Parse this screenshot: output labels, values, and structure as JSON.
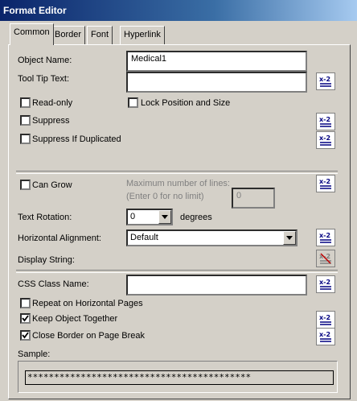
{
  "window": {
    "title": "Format Editor"
  },
  "tabs": [
    {
      "label": "Common"
    },
    {
      "label": "Border"
    },
    {
      "label": "Font"
    },
    {
      "label": "Hyperlink"
    }
  ],
  "common": {
    "object_name_label": "Object Name:",
    "object_name_value": "Medical1",
    "tooltip_label": "Tool Tip Text:",
    "tooltip_value": "",
    "read_only_label": "Read-only",
    "lock_position_label": "Lock Position and Size",
    "suppress_label": "Suppress",
    "suppress_dup_label": "Suppress If Duplicated",
    "can_grow_label": "Can Grow",
    "max_lines_label": "Maximum number of lines:",
    "max_lines_hint": "(Enter 0 for no limit)",
    "max_lines_value": "0",
    "text_rotation_label": "Text Rotation:",
    "text_rotation_value": "0",
    "degrees_label": "degrees",
    "horiz_align_label": "Horizontal Alignment:",
    "horiz_align_value": "Default",
    "display_string_label": "Display String:",
    "css_class_label": "CSS Class Name:",
    "css_class_value": "",
    "repeat_pages_label": "Repeat on Horizontal Pages",
    "keep_together_label": "Keep Object Together",
    "close_border_label": "Close Border on Page Break",
    "sample_label": "Sample:",
    "sample_value": "******************************************"
  },
  "checks": {
    "read_only": false,
    "lock_position": false,
    "suppress": false,
    "suppress_dup": false,
    "can_grow": false,
    "repeat_pages": false,
    "keep_together": true,
    "close_border": true
  },
  "colors": {
    "formula_icon": "#000080",
    "checkmark": "#000000"
  }
}
